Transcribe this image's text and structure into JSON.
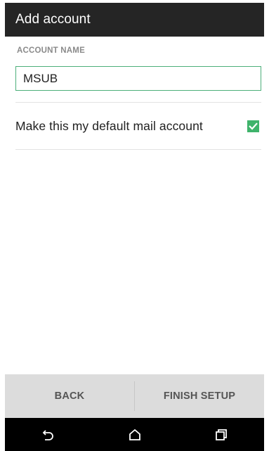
{
  "header": {
    "title": "Add account"
  },
  "form": {
    "account_name_label": "ACCOUNT NAME",
    "account_name_value": "MSUB",
    "default_account_label": "Make this my default mail account",
    "default_account_checked": true
  },
  "footer": {
    "back_label": "BACK",
    "finish_label": "FINISH SETUP"
  },
  "navigation_bar": {
    "icons": [
      "back-icon",
      "home-icon",
      "recent-apps-icon"
    ]
  },
  "colors": {
    "header_bg": "#252525",
    "accent_green": "#3fb36b",
    "footer_bg": "#dcdcdc"
  }
}
